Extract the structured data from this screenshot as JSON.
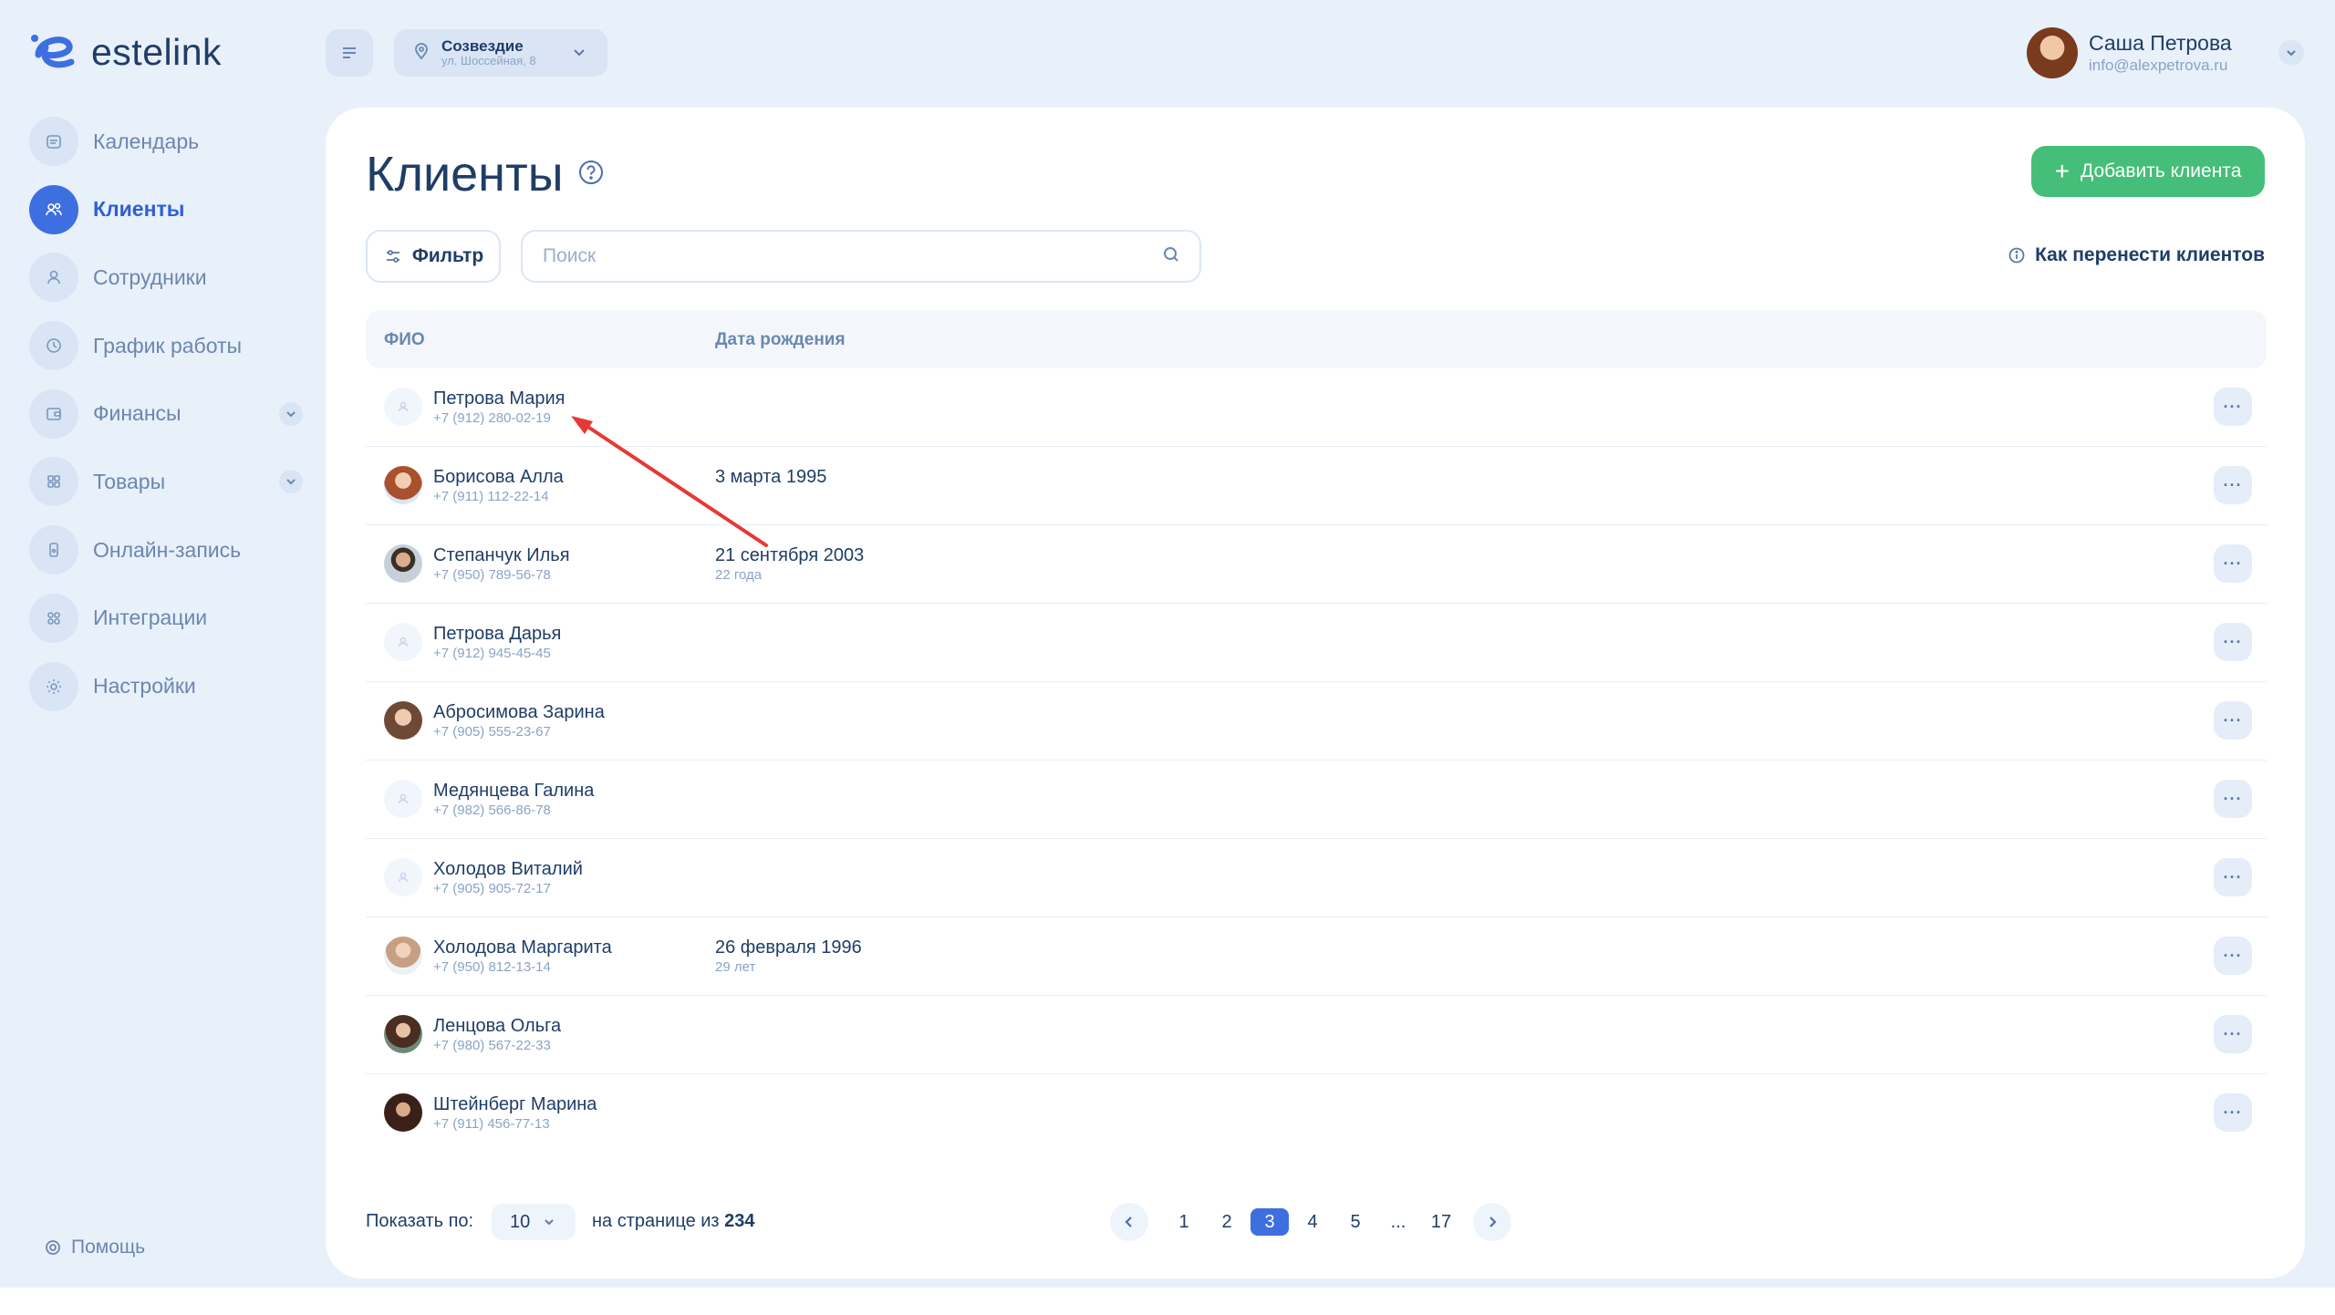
{
  "brand": {
    "name": "estelink",
    "accent": "#3e6fe0",
    "success": "#45be79"
  },
  "header": {
    "location": {
      "name": "Созвездие",
      "address": "ул. Шоссейная, 8"
    },
    "user": {
      "name": "Саша Петрова",
      "email": "info@alexpetrova.ru"
    }
  },
  "sidebar": {
    "items": [
      {
        "label": "Календарь",
        "icon": "calendar-icon"
      },
      {
        "label": "Клиенты",
        "icon": "clients-icon",
        "active": true
      },
      {
        "label": "Сотрудники",
        "icon": "employee-icon"
      },
      {
        "label": "График работы",
        "icon": "clock-icon"
      },
      {
        "label": "Финансы",
        "icon": "wallet-icon",
        "expandable": true
      },
      {
        "label": "Товары",
        "icon": "boxes-icon",
        "expandable": true
      },
      {
        "label": "Онлайн-запись",
        "icon": "phone-icon"
      },
      {
        "label": "Интеграции",
        "icon": "grid-icon"
      },
      {
        "label": "Настройки",
        "icon": "gear-icon"
      }
    ],
    "help": "Помощь"
  },
  "page": {
    "title": "Клиенты",
    "add_button": "Добавить клиента",
    "filter_button": "Фильтр",
    "search_placeholder": "Поиск",
    "migrate_link": "Как перенести клиентов"
  },
  "table": {
    "columns": {
      "name": "ФИО",
      "birth": "Дата рождения"
    },
    "rows": [
      {
        "name": "Петрова Мария",
        "phone": "+7 (912) 280-02-19",
        "birth": "",
        "age": "",
        "avatar": "none"
      },
      {
        "name": "Борисова Алла",
        "phone": "+7 (911) 112-22-14",
        "birth": "3 марта 1995",
        "age": "",
        "avatar": "photo"
      },
      {
        "name": "Степанчук Илья",
        "phone": "+7 (950) 789-56-78",
        "birth": "21 сентября 2003",
        "age": "22 года",
        "avatar": "photo"
      },
      {
        "name": "Петрова Дарья",
        "phone": "+7 (912) 945-45-45",
        "birth": "",
        "age": "",
        "avatar": "none"
      },
      {
        "name": "Абросимова Зарина",
        "phone": "+7 (905) 555-23-67",
        "birth": "",
        "age": "",
        "avatar": "photo"
      },
      {
        "name": "Медянцева Галина",
        "phone": "+7 (982) 566-86-78",
        "birth": "",
        "age": "",
        "avatar": "none"
      },
      {
        "name": "Холодов Виталий",
        "phone": "+7 (905) 905-72-17",
        "birth": "",
        "age": "",
        "avatar": "none"
      },
      {
        "name": "Холодова Маргарита",
        "phone": "+7 (950) 812-13-14",
        "birth": "26 февраля 1996",
        "age": "29 лет",
        "avatar": "photo"
      },
      {
        "name": "Ленцова Ольга",
        "phone": "+7 (980) 567-22-33",
        "birth": "",
        "age": "",
        "avatar": "photo"
      },
      {
        "name": "Штейнберг Марина",
        "phone": "+7 (911) 456-77-13",
        "birth": "",
        "age": "",
        "avatar": "photo"
      }
    ],
    "more_label": "···"
  },
  "footer": {
    "show_per_label": "Показать по:",
    "per_page": "10",
    "total_prefix": "на странице из",
    "total": "234",
    "pages": [
      "1",
      "2",
      "3",
      "4",
      "5",
      "...",
      "17"
    ],
    "current_page": "3"
  }
}
